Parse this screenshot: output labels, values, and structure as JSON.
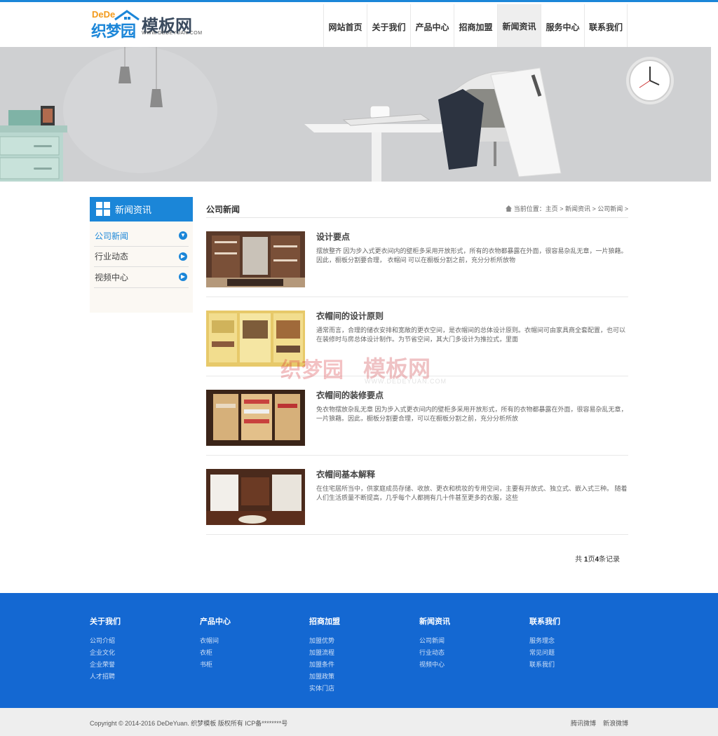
{
  "header": {
    "logo_top": "DeDe",
    "logo_cn": "织梦园",
    "logo_brand": "模板网",
    "logo_url": "WWW.DEDEYUAN.COM"
  },
  "nav": [
    {
      "label": "网站首页"
    },
    {
      "label": "关于我们"
    },
    {
      "label": "产品中心"
    },
    {
      "label": "招商加盟"
    },
    {
      "label": "新闻资讯",
      "active": true
    },
    {
      "label": "服务中心"
    },
    {
      "label": "联系我们"
    }
  ],
  "sidebar": {
    "title": "新闻资讯",
    "items": [
      {
        "label": "公司新闻",
        "active": true
      },
      {
        "label": "行业动态"
      },
      {
        "label": "视频中心"
      }
    ]
  },
  "main": {
    "title": "公司新闻",
    "breadcrumb": "当前位置：主页 > 新闻资讯 > 公司新闻 >",
    "news": [
      {
        "title": "设计要点",
        "desc": "摆放整齐 因为步入式更衣间内的壁柜多采用开放形式，所有的衣物都暴露在外面，很容易杂乱无章，一片狼藉。因此，橱板分割要合理， 衣帽间 可以在橱板分割之前，充分分析所放物"
      },
      {
        "title": "衣帽间的设计原则",
        "desc": "通常而言，合理的储衣安排和宽敞的更衣空间，是衣帽间的总体设计原则。衣帽间可由家具商全套配置，也可以在装修时与房总体设计制作。为节省空间，其大门多设计为推拉式，里面"
      },
      {
        "title": "衣帽间的装修要点",
        "desc": "免衣物摆放杂乱无章 因为步入式更衣间内的壁柜多采用开放形式，所有的衣物都暴露在外面，很容易杂乱无章，一片狼藉。因此，橱板分割要合理，可以在橱板分割之前，充分分析所放"
      },
      {
        "title": "衣帽间基本解释",
        "desc": "在住宅居所当中，供家庭成员存储、收放、更衣和梳妆的专用空间，主要有开放式、独立式、嵌入式三种。 随着人们生活质量不断提高，几乎每个人都拥有几十件甚至更多的衣服，这些"
      }
    ],
    "pager": {
      "prefix": "共 ",
      "pages": "1",
      "mid": "页",
      "count": "4",
      "suffix": "条记录"
    }
  },
  "watermark": {
    "cn": "织梦园",
    "brand": "模板网",
    "url": "WWW.DEDEYUAN.COM"
  },
  "footer": {
    "columns": [
      {
        "heading": "关于我们",
        "links": [
          "公司介绍",
          "企业文化",
          "企业荣誉",
          "人才招聘"
        ]
      },
      {
        "heading": "产品中心",
        "links": [
          "衣帽间",
          "衣柜",
          "书柜"
        ]
      },
      {
        "heading": "招商加盟",
        "links": [
          "加盟优势",
          "加盟流程",
          "加盟条件",
          "加盟政策",
          "实体门店"
        ]
      },
      {
        "heading": "新闻资讯",
        "links": [
          "公司新闻",
          "行业动态",
          "视频中心"
        ]
      },
      {
        "heading": "联系我们",
        "links": [
          "服务理念",
          "常见问题",
          "联系我们"
        ]
      }
    ],
    "copyright": "Copyright © 2014-2016 DeDeYuan. 织梦模板 版权所有  ICP备********号",
    "social": [
      "腾讯微博",
      "新浪微博"
    ]
  },
  "colors": {
    "accent": "#1b86d8",
    "footer_bg": "#1468d2",
    "banner_bg": "#cfd0d2"
  }
}
